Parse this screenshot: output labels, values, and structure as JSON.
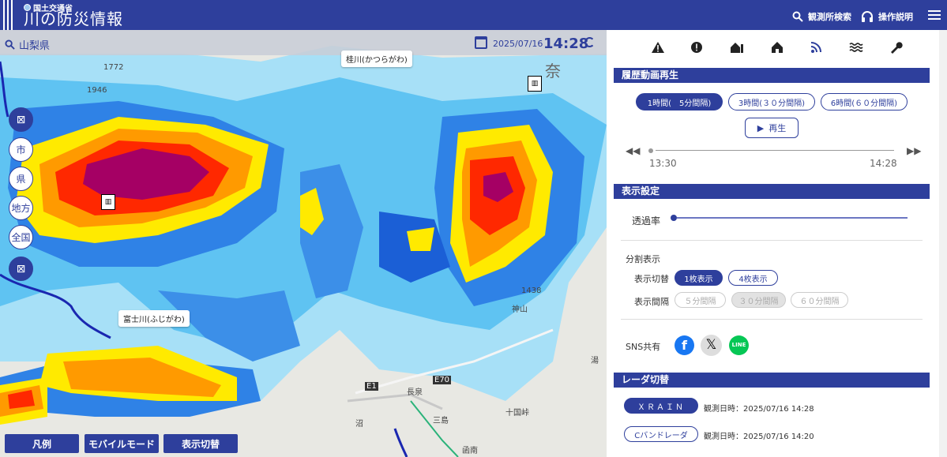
{
  "header": {
    "agency": "国土交通省",
    "title": "川の防災情報",
    "search_label": "観測所検索",
    "help_label": "操作説明",
    "bg_color": "#2e3f9c"
  },
  "map": {
    "prefecture": "山梨県",
    "date": "2025/07/16",
    "time": "14:28",
    "left_buttons": [
      "市",
      "県",
      "地方",
      "全国"
    ],
    "river_labels": [
      "桂川(かつらがわ)",
      "富士川(ふじがわ)"
    ],
    "map_texts": [
      "奈",
      "1772",
      "1946",
      "1438",
      "神山",
      "長泉",
      "E1",
      "E70",
      "十国峠",
      "沼",
      "函南",
      "湯",
      "三島"
    ],
    "bottom_buttons": [
      "凡例",
      "モバイルモード",
      "表示切替"
    ]
  },
  "panel": {
    "nav_icons": [
      "warning-icon",
      "alert-circle-icon",
      "house-list-icon",
      "house-icon",
      "radar-icon",
      "waves-icon",
      "wrench-icon"
    ],
    "history": {
      "title": "履歴動画再生",
      "intervals": [
        "1時間(　5分間隔)",
        "3時間(３０分間隔)",
        "6時間(６０分間隔)"
      ],
      "play_label": "再生",
      "start_time": "13:30",
      "end_time": "14:28"
    },
    "display": {
      "title": "表示設定",
      "opacity_label": "透過率",
      "split_title": "分割表示",
      "switch_label": "表示切替",
      "switch_options": [
        "1枚表示",
        "4枚表示"
      ],
      "interval_label": "表示間隔",
      "interval_options": [
        "５分間隔",
        "３０分間隔",
        "６０分間隔"
      ],
      "sns_label": "SNS共有"
    },
    "radar": {
      "title": "レーダ切替",
      "items": [
        {
          "name": "ＸＲＡＩＮ",
          "time": "観測日時：2025/07/16 14:28"
        },
        {
          "name": "Cバンドレーダ",
          "time": "観測日時：2025/07/16 14:20"
        }
      ]
    }
  }
}
